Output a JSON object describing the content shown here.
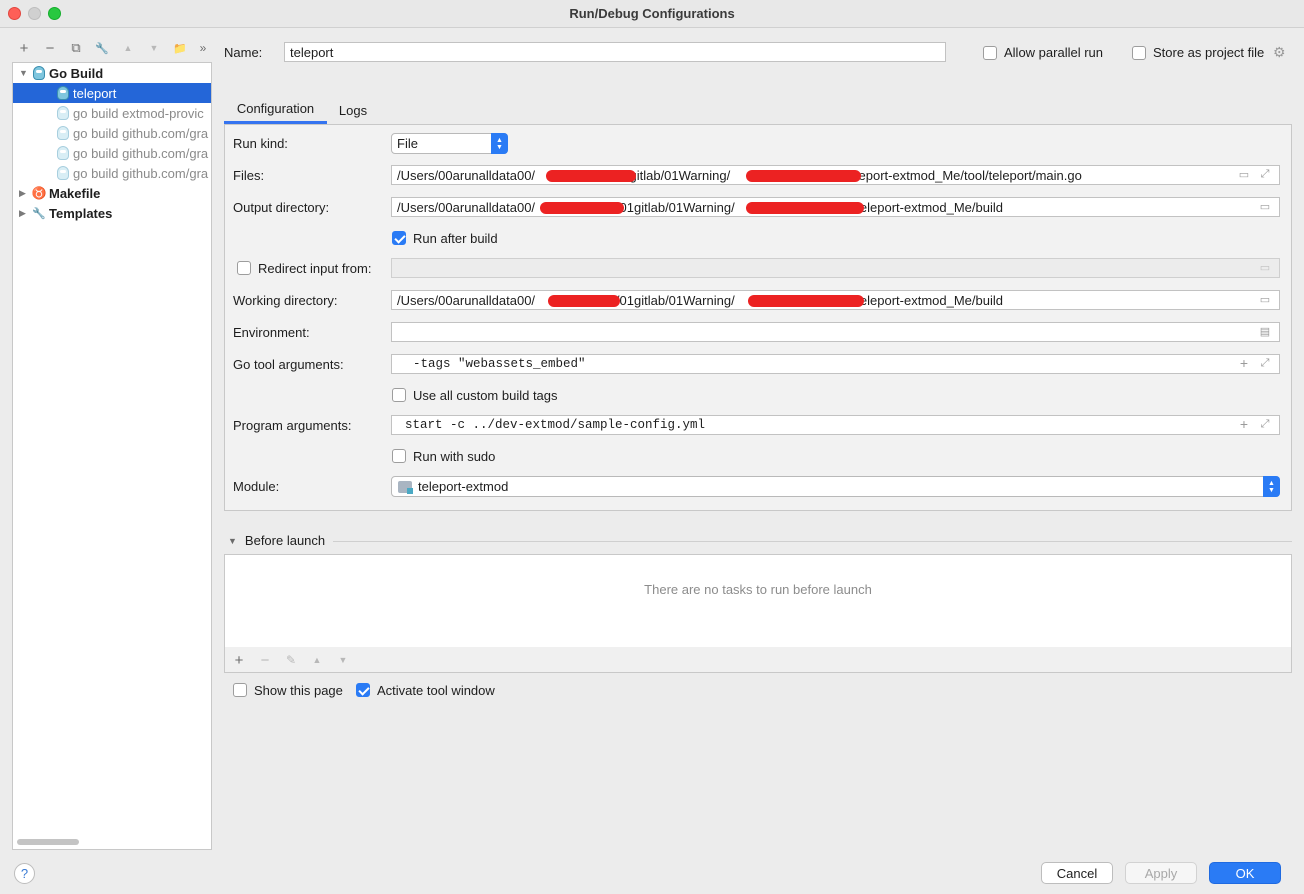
{
  "window": {
    "title": "Run/Debug Configurations"
  },
  "toolbar": {
    "add_icon": "+",
    "remove_icon": "−",
    "copy_icon": "⧉",
    "wrench_icon": "🔧",
    "up_icon": "▲",
    "down_icon": "▼",
    "folder_icon": "📁",
    "more_icon": "»"
  },
  "tree": {
    "items": [
      {
        "label": "Go Build"
      },
      {
        "label": "teleport"
      },
      {
        "label": "go build extmod-provic"
      },
      {
        "label": "go build github.com/gra"
      },
      {
        "label": "go build github.com/gra"
      },
      {
        "label": "go build github.com/gra"
      },
      {
        "label": "Makefile"
      },
      {
        "label": "Templates"
      }
    ]
  },
  "header": {
    "name_label": "Name:",
    "name_value": "teleport",
    "allow_parallel_label": "Allow parallel run",
    "store_project_label": "Store as project file"
  },
  "tabs": [
    {
      "label": "Configuration"
    },
    {
      "label": "Logs"
    }
  ],
  "config": {
    "run_kind_label": "Run kind:",
    "run_kind_value": "File",
    "files_label": "Files:",
    "files_value_a": "/Users/00arunalldata00/",
    "files_value_b": "01gitlab/01Warning/",
    "files_value_c": "/teleport-extmod_Me/tool/teleport/main.go",
    "output_label": "Output directory:",
    "output_value_a": "/Users/00arunalldata00/",
    "output_value_b": "l/01gitlab/01Warning/",
    "output_value_c": "/teleport-extmod_Me/build",
    "run_after_build_label": "Run after build",
    "redirect_label": "Redirect input from:",
    "working_label": "Working directory:",
    "working_value_a": "/Users/00arunalldata00/",
    "working_value_b": "l/01gitlab/01Warning/",
    "working_value_c": "/teleport-extmod_Me/build",
    "environment_label": "Environment:",
    "go_tool_label": "Go tool arguments:",
    "go_tool_value": "-tags \"webassets_embed\"",
    "use_custom_tags_label": "Use all custom build tags",
    "program_args_label": "Program arguments:",
    "program_args_value": "start -c ../dev-extmod/sample-config.yml",
    "run_sudo_label": "Run with sudo",
    "module_label": "Module:",
    "module_value": "teleport-extmod"
  },
  "before_launch": {
    "title": "Before launch",
    "empty_text": "There are no tasks to run before launch"
  },
  "footer": {
    "show_page_label": "Show this page",
    "activate_tool_label": "Activate tool window",
    "help_label": "?",
    "cancel_label": "Cancel",
    "apply_label": "Apply",
    "ok_label": "OK"
  },
  "colors": {
    "accent": "#2a7bf5",
    "selection": "#2466d8",
    "redaction": "#ec2222"
  }
}
